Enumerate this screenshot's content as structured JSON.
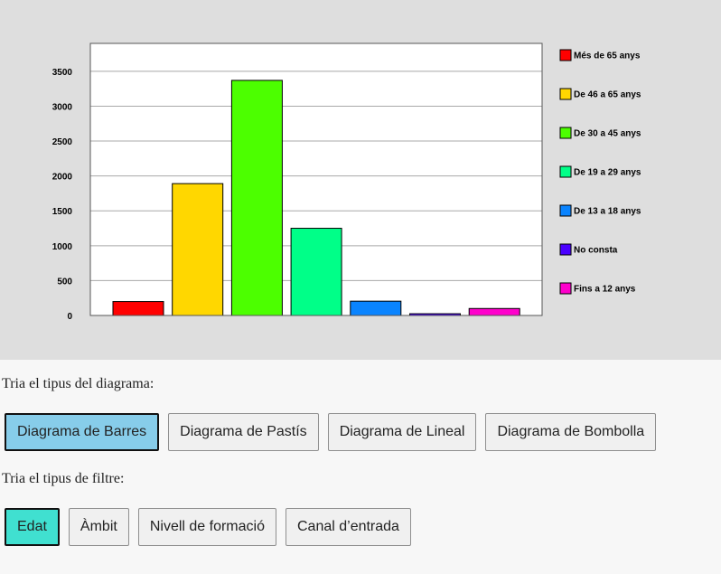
{
  "chart_data": {
    "type": "bar",
    "categories": [
      "Més de 65 anys",
      "De 46 a 65 anys",
      "De 30 a 45 anys",
      "De 19 a 29 anys",
      "De 13 a 18 anys",
      "No consta",
      "Fins a 12 anys"
    ],
    "values": [
      200,
      1890,
      3370,
      1250,
      205,
      25,
      100
    ],
    "colors": [
      "#ff0000",
      "#ffd700",
      "#4cff00",
      "#00ff88",
      "#0a84ff",
      "#4a00ff",
      "#ff00cc"
    ],
    "ylim": [
      0,
      3900
    ],
    "yticks": [
      0,
      500,
      1000,
      1500,
      2000,
      2500,
      3000,
      3500
    ],
    "legend_position": "right",
    "grid": true,
    "title": "",
    "xlabel": "",
    "ylabel": ""
  },
  "diagram_prompt": "Tria el tipus del diagrama:",
  "diagram_buttons": [
    "Diagrama de Barres",
    "Diagrama de Pastís",
    "Diagrama de Lineal",
    "Diagrama de Bombolla"
  ],
  "filter_prompt": "Tria el tipus de filtre:",
  "filter_buttons": [
    "Edat",
    "Àmbit",
    "Nivell de formació",
    "Canal d’entrada"
  ]
}
